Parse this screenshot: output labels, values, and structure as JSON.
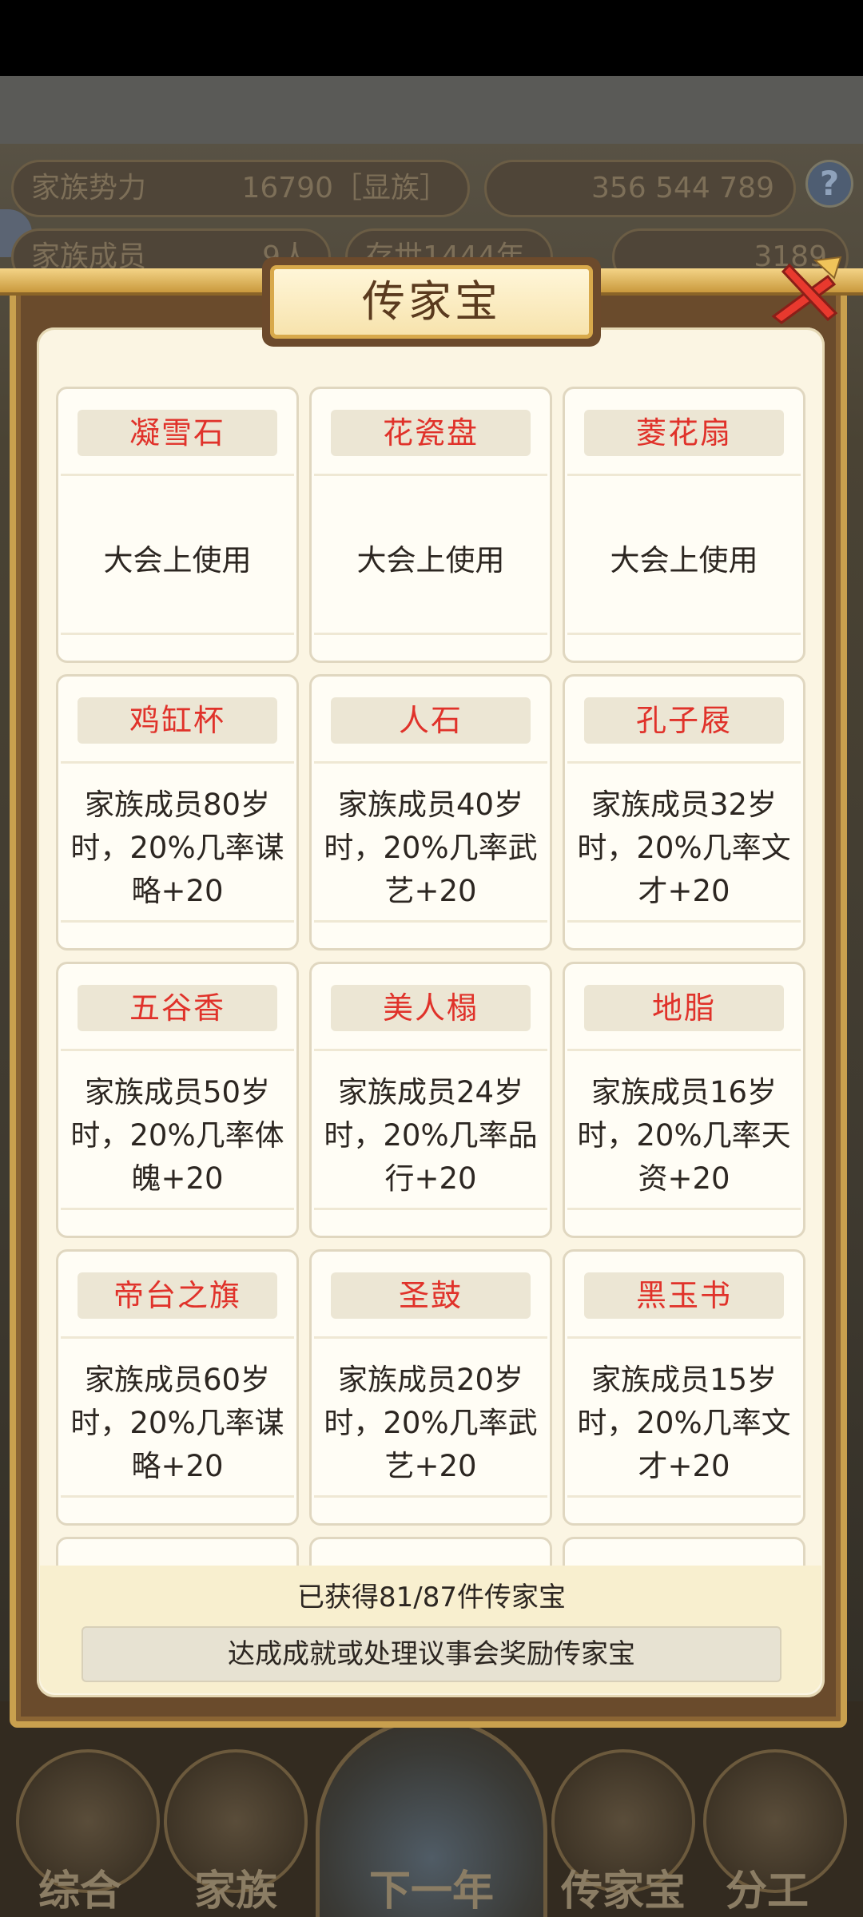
{
  "background": {
    "stats": [
      {
        "label": "家族势力",
        "value": "16790［显族］"
      },
      {
        "label": "",
        "value": "356 544 789"
      },
      {
        "label": "家族成员",
        "value": "9人"
      },
      {
        "label": "存世1444年",
        "value": ""
      },
      {
        "label": "",
        "value": "3189"
      }
    ],
    "help_label": "?",
    "nav": [
      "综合",
      "家族",
      "下一年",
      "传家宝",
      "分工"
    ]
  },
  "dialog": {
    "title": "传家宝",
    "close_icon": "close-x-icon",
    "items": [
      {
        "name": "凝雪石",
        "desc": "大会上使用"
      },
      {
        "name": "花瓷盘",
        "desc": "大会上使用"
      },
      {
        "name": "菱花扇",
        "desc": "大会上使用"
      },
      {
        "name": "鸡缸杯",
        "desc": "家族成员80岁时，20%几率谋略+20"
      },
      {
        "name": "人石",
        "desc": "家族成员40岁时，20%几率武艺+20"
      },
      {
        "name": "孔子屐",
        "desc": "家族成员32岁时，20%几率文才+20"
      },
      {
        "name": "五谷香",
        "desc": "家族成员50岁时，20%几率体魄+20"
      },
      {
        "name": "美人榻",
        "desc": "家族成员24岁时，20%几率品行+20"
      },
      {
        "name": "地脂",
        "desc": "家族成员16岁时，20%几率天资+20"
      },
      {
        "name": "帝台之旗",
        "desc": "家族成员60岁时，20%几率谋略+20"
      },
      {
        "name": "圣鼓",
        "desc": "家族成员20岁时，20%几率武艺+20"
      },
      {
        "name": "黑玉书",
        "desc": "家族成员15岁时，20%几率文才+20"
      }
    ],
    "count_text": "已获得81/87件传家宝",
    "hint_text": "达成成就或处理议事会奖励传家宝"
  },
  "colors": {
    "item_name": "#e0322a",
    "panel": "#fbf5e3",
    "frame": "#c9a04e"
  }
}
